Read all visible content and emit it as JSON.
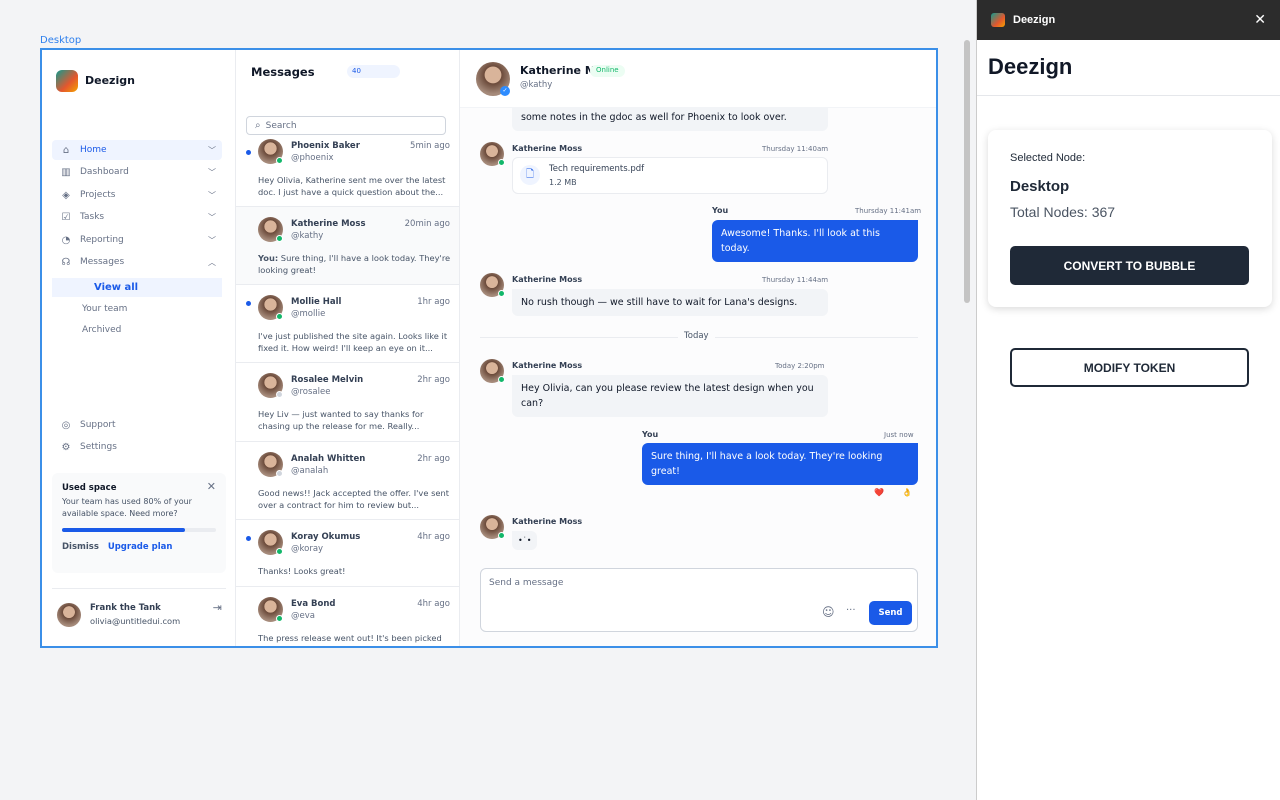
{
  "canvas": {
    "frame_label": "Desktop"
  },
  "sidebar": {
    "brand": "Deezign",
    "nav": [
      {
        "label": "Home",
        "icon": "home-icon",
        "active": true
      },
      {
        "label": "Dashboard",
        "icon": "bar-chart-icon"
      },
      {
        "label": "Projects",
        "icon": "layers-icon"
      },
      {
        "label": "Tasks",
        "icon": "tasks-icon"
      },
      {
        "label": "Reporting",
        "icon": "pie-chart-icon"
      },
      {
        "label": "Messages",
        "icon": "messages-icon",
        "expanded": true
      }
    ],
    "sub": [
      "View all",
      "Your team",
      "Archived"
    ],
    "footer_nav": [
      {
        "label": "Support",
        "icon": "life-buoy-icon"
      },
      {
        "label": "Settings",
        "icon": "gear-icon"
      }
    ],
    "storage": {
      "title": "Used space",
      "text": "Your team has used 80% of your available space. Need more?",
      "percent": 80,
      "dismiss": "Dismiss",
      "upgrade": "Upgrade plan"
    },
    "user": {
      "name": "Frank the Tank",
      "email": "olivia@untitledui.com"
    }
  },
  "list": {
    "title": "Messages",
    "count": "40",
    "search_placeholder": "Search",
    "conversations": [
      {
        "name": "Phoenix Baker",
        "handle": "@phoenix",
        "time": "5min ago",
        "text": "Hey Olivia, Katherine sent me over the latest doc. I just have a quick question about the...",
        "unread": true,
        "online": true
      },
      {
        "name": "Katherine Moss",
        "handle": "@kathy",
        "time": "20min ago",
        "you": "You:",
        "text": " Sure thing, I'll have a look today. They're looking great!",
        "unread": false,
        "online": true,
        "selected": true
      },
      {
        "name": "Mollie Hall",
        "handle": "@mollie",
        "time": "1hr ago",
        "text": "I've just published the site again. Looks like it fixed it. How weird! I'll keep an eye on it...",
        "unread": true,
        "online": true
      },
      {
        "name": "Rosalee Melvin",
        "handle": "@rosalee",
        "time": "2hr ago",
        "text": "Hey Liv — just wanted to say thanks for chasing up the release for me. Really...",
        "unread": false,
        "online": false
      },
      {
        "name": "Analah Whitten",
        "handle": "@analah",
        "time": "2hr ago",
        "text": "Good news!! Jack accepted the offer. I've sent over a contract for him to review but...",
        "unread": false,
        "online": false
      },
      {
        "name": "Koray Okumus",
        "handle": "@koray",
        "time": "4hr ago",
        "text": "Thanks! Looks great!",
        "unread": true,
        "online": true
      },
      {
        "name": "Eva Bond",
        "handle": "@eva",
        "time": "4hr ago",
        "text": "The press release went out! It's been picked",
        "unread": false,
        "online": true
      }
    ]
  },
  "chat": {
    "name": "Katherine Moss",
    "status": "Online",
    "handle": "@kathy",
    "m0": "some notes in the gdoc as well for Phoenix to look over.",
    "m1": {
      "sender": "Katherine Moss",
      "time": "Thursday 11:40am",
      "file": "Tech requirements.pdf",
      "size": "1.2 MB"
    },
    "m2": {
      "sender": "You",
      "time": "Thursday 11:41am",
      "text": "Awesome! Thanks. I'll look at this today."
    },
    "m3": {
      "sender": "Katherine Moss",
      "time": "Thursday 11:44am",
      "text": "No rush though — we still have to wait for Lana's designs."
    },
    "divider": "Today",
    "m4": {
      "sender": "Katherine Moss",
      "time": "Today 2:20pm",
      "text": "Hey Olivia, can you please review the latest design when you can?"
    },
    "m5": {
      "sender": "You",
      "time": "Just now",
      "text": "Sure thing, I'll have a look today. They're looking great!",
      "reactions": [
        "❤️",
        "👌"
      ]
    },
    "m6": {
      "sender": "Katherine Moss",
      "typing": "•˙•"
    },
    "composer": {
      "placeholder": "Send a message",
      "send": "Send"
    }
  },
  "plugin": {
    "window_title": "Deezign",
    "heading": "Deezign",
    "selected_label": "Selected Node:",
    "node": "Desktop",
    "total": "Total Nodes: 367",
    "convert": "CONVERT TO BUBBLE",
    "modify": "MODIFY TOKEN"
  }
}
